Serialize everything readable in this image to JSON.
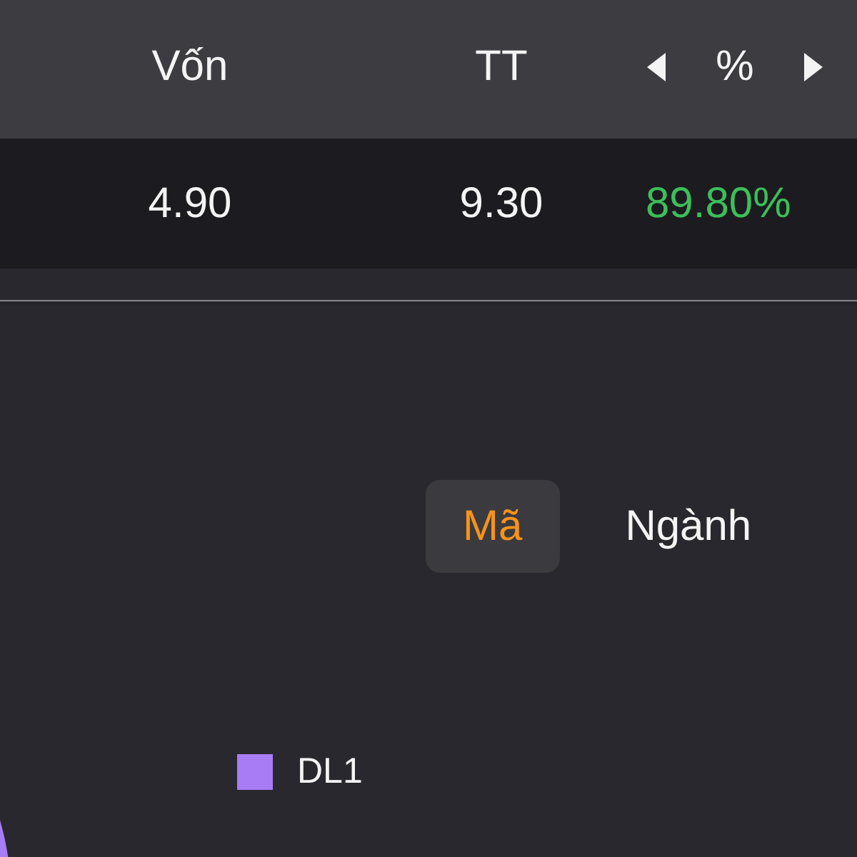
{
  "table": {
    "columns": [
      {
        "label": "Vốn",
        "kind": "plain"
      },
      {
        "label": "TT",
        "kind": "plain"
      },
      {
        "label": "%",
        "kind": "switcher"
      }
    ],
    "rows": [
      {
        "cells": [
          {
            "text": "4.90",
            "kind": "value"
          },
          {
            "text": "9.30",
            "kind": "value"
          },
          {
            "text": "89.80%",
            "kind": "change",
            "positive": true
          }
        ]
      }
    ]
  },
  "tabs": [
    {
      "label": "Mã",
      "selected": true
    },
    {
      "label": "Ngành",
      "selected": false
    }
  ],
  "chart": {
    "legend": [
      {
        "label": "DL1",
        "color": "#a87cf5"
      }
    ]
  }
}
